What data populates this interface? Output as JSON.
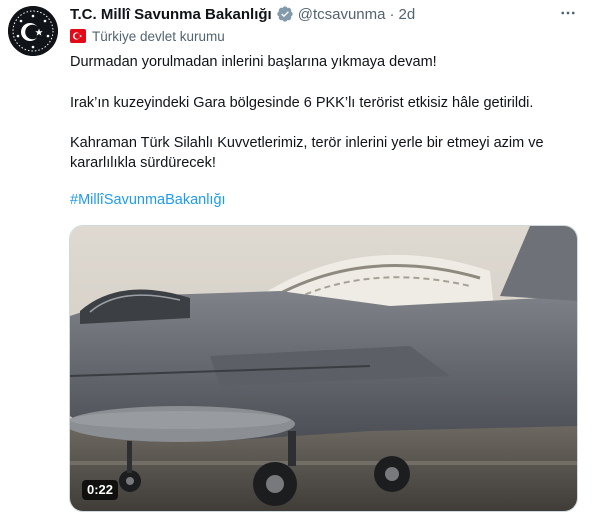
{
  "tweet": {
    "author": {
      "name": "T.C. Millî Savunma Bakanlığı",
      "handle": "@tcsavunma",
      "separator": "·",
      "time": "2d",
      "verified_badge_icon": "verified-badge-gray-icon",
      "affiliation": "Türkiye devlet kurumu",
      "affiliation_icon": "turkey-flag-icon"
    },
    "more_icon": "more-options-icon",
    "paragraphs": [
      "Durmadan yorulmadan inlerini başlarına yıkmaya devam!",
      "Irak’ın kuzeyindeki Gara bölgesinde 6 PKK’lı terörist etkisiz hâle getirildi.",
      "Kahraman Türk Silahlı Kuvvetlerimiz, terör inlerini yerle bir etmeyi azim ve kararlılıkla sürdürecek!"
    ],
    "hashtag": "#MillîSavunmaBakanlığı",
    "media": {
      "type": "video",
      "duration": "0:22"
    }
  },
  "colors": {
    "text": "#0f1419",
    "secondary": "#536471",
    "link": "#1d9bf0",
    "flag_red": "#e30a17",
    "badge_gray": "#829aab"
  }
}
